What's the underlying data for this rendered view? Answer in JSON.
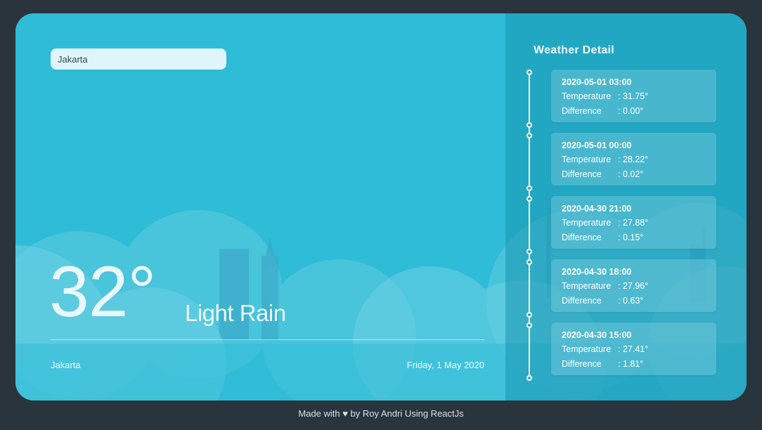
{
  "search": {
    "value": "Jakarta"
  },
  "current": {
    "temperature": "32°",
    "condition": "Light Rain",
    "city": "Jakarta",
    "date": "Friday, 1 May 2020"
  },
  "detail": {
    "title": "Weather Detail",
    "entries": [
      {
        "datetime": "2020-05-01 03:00",
        "temperature_label": "Temperature",
        "temperature": ": 31.75°",
        "difference_label": "Difference",
        "difference": ": 0.00°"
      },
      {
        "datetime": "2020-05-01 00:00",
        "temperature_label": "Temperature",
        "temperature": ": 28.22°",
        "difference_label": "Difference",
        "difference": ": 0.02°"
      },
      {
        "datetime": "2020-04-30 21:00",
        "temperature_label": "Temperature",
        "temperature": ": 27.88°",
        "difference_label": "Difference",
        "difference": ": 0.15°"
      },
      {
        "datetime": "2020-04-30 18:00",
        "temperature_label": "Temperature",
        "temperature": ": 27.96°",
        "difference_label": "Difference",
        "difference": ": 0.63°"
      },
      {
        "datetime": "2020-04-30 15:00",
        "temperature_label": "Temperature",
        "temperature": ": 27.41°",
        "difference_label": "Difference",
        "difference": ": 1.81°"
      }
    ]
  },
  "footer": {
    "text": "Made with ♥ by Roy Andri Using ReactJs"
  },
  "colors": {
    "background": "#2a343c",
    "card": "#2ebcd6",
    "panel": "#27a9c4"
  }
}
